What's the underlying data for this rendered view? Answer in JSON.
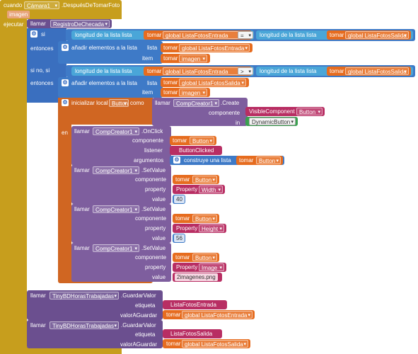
{
  "event": {
    "when": "cuando",
    "component": "Cámara1",
    "event": ".DespuésDeTomarFoto",
    "param": "imagen",
    "do": "ejecutar"
  },
  "call1": {
    "call": "llamar",
    "proc": "RegistroDeChecada"
  },
  "if": {
    "if": "si",
    "then": "entonces",
    "elseif": "si no, si",
    "then2": "entonces"
  },
  "list": {
    "length_of": "longitud de la lista  lista",
    "get": "tomar",
    "var_in": "global ListaFotosEntrada",
    "var_out": "global ListaFotosSalida",
    "eq": "=",
    "gt": ">",
    "add_items": "añadir elementos a la lista",
    "lista": "lista",
    "item": "item",
    "imagen": "imagen"
  },
  "local": {
    "init": "inicializar local",
    "name": "Button",
    "as": "como",
    "in": "en"
  },
  "create": {
    "call": "llamar",
    "comp": "CompCreator1",
    "method": ".Create",
    "componente": "componente",
    "visible": "VisibleComponent",
    "visible_val": "Button",
    "in": "in",
    "dynamic": "DynamicButton"
  },
  "onclick": {
    "call": "llamar",
    "comp": "CompCreator1",
    "method": ".OnClick",
    "componente": "componente",
    "listener": "listener",
    "listener_val": "ButtonClicked",
    "argumentos": "argumentos",
    "build_list": "construye una lista"
  },
  "setvalues": [
    {
      "call": "llamar",
      "comp": "CompCreator1",
      "method": ".SetValue",
      "componente": "componente",
      "property": "property",
      "prop": "Property",
      "prop_val": "Width",
      "value": "value",
      "val": "40"
    },
    {
      "call": "llamar",
      "comp": "CompCreator1",
      "method": ".SetValue",
      "componente": "componente",
      "property": "property",
      "prop": "Property",
      "prop_val": "Height",
      "value": "value",
      "val": "56"
    },
    {
      "call": "llamar",
      "comp": "CompCreator1",
      "method": ".SetValue",
      "componente": "componente",
      "property": "property",
      "prop": "Property",
      "prop_val": "Image",
      "value": "value",
      "val": "2imagenes.png"
    }
  ],
  "tinydb": [
    {
      "call": "llamar",
      "comp": "TinyBDHorasTrabajadas",
      "method": ".GuardarValor",
      "tag": "etiqueta",
      "tag_val": "ListaFotosEntrada",
      "store": "valorAGuardar",
      "store_var": "global ListaFotosEntrada"
    },
    {
      "call": "llamar",
      "comp": "TinyBDHorasTrabajadas",
      "method": ".GuardarValor",
      "tag": "etiqueta",
      "tag_val": "ListaFotosSalida",
      "store": "valorAGuardar",
      "store_var": "global ListaFotosSalida"
    }
  ],
  "colors": {
    "event": "#c79e1d",
    "control": "#d06622",
    "component": "#6b4f8f",
    "list": "#3e7ac7",
    "variable": "#e66c1f",
    "text": "#b82e63"
  }
}
